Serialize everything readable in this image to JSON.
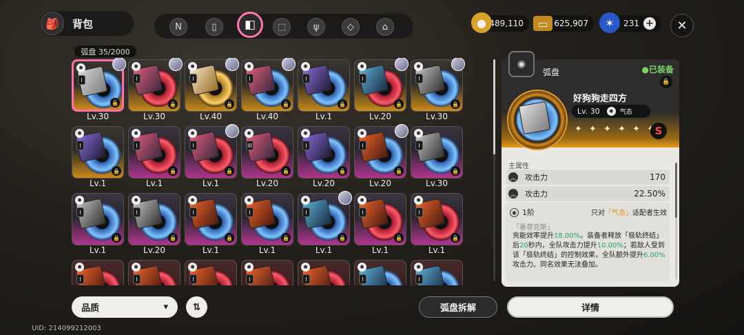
{
  "header": {
    "title": "背包",
    "bag_icon": "backpack-icon"
  },
  "tabs": [
    {
      "icon": "n-logo-icon"
    },
    {
      "icon": "device-icon"
    },
    {
      "icon": "disc-case-icon",
      "active": true
    },
    {
      "icon": "box-icon"
    },
    {
      "icon": "fork-knife-icon"
    },
    {
      "icon": "package-icon"
    },
    {
      "icon": "house-icon"
    }
  ],
  "currencies": [
    {
      "icon": "coin-icon",
      "value": "489,110"
    },
    {
      "icon": "ticket-icon",
      "value": "625,907"
    },
    {
      "icon": "crystal-icon",
      "value": "231"
    }
  ],
  "inventory": {
    "label": "弧盘 35/2000"
  },
  "items": [
    {
      "lv": "Lv.30",
      "rank": "I",
      "style": "gold",
      "cover": "",
      "disc": "",
      "avatar": true,
      "selected": true
    },
    {
      "lv": "Lv.30",
      "rank": "I",
      "style": "gold",
      "cover": "c2",
      "disc": "red",
      "avatar": true
    },
    {
      "lv": "Lv.40",
      "rank": "I",
      "style": "gold",
      "cover": "c3",
      "disc": "gold",
      "avatar": true
    },
    {
      "lv": "Lv.40",
      "rank": "I",
      "style": "gold",
      "cover": "c2",
      "disc": "",
      "avatar": true
    },
    {
      "lv": "Lv.1",
      "rank": "I",
      "style": "gold",
      "cover": "c4",
      "disc": "",
      "avatar": false
    },
    {
      "lv": "Lv.20",
      "rank": "I",
      "style": "gold",
      "cover": "c6",
      "disc": "red",
      "avatar": true
    },
    {
      "lv": "Lv.30",
      "rank": "I",
      "style": "gold",
      "cover": "c7",
      "disc": "",
      "avatar": true
    },
    {
      "lv": "Lv.1",
      "rank": "I",
      "style": "gold",
      "cover": "c4",
      "disc": "",
      "avatar": false
    },
    {
      "lv": "Lv.1",
      "rank": "I",
      "style": "purple",
      "cover": "c2",
      "disc": "red",
      "avatar": false
    },
    {
      "lv": "Lv.1",
      "rank": "I",
      "style": "purple",
      "cover": "c2",
      "disc": "red",
      "avatar": true
    },
    {
      "lv": "Lv.20",
      "rank": "III",
      "style": "purple",
      "cover": "c2",
      "disc": "red",
      "avatar": false
    },
    {
      "lv": "Lv.20",
      "rank": "I",
      "style": "purple",
      "cover": "c4",
      "disc": "",
      "avatar": false
    },
    {
      "lv": "Lv.20",
      "rank": "I",
      "style": "purple",
      "cover": "c5",
      "disc": "",
      "avatar": true
    },
    {
      "lv": "Lv.30",
      "rank": "I",
      "style": "purple",
      "cover": "c7",
      "disc": "",
      "avatar": false
    },
    {
      "lv": "Lv.1",
      "rank": "I",
      "style": "purple",
      "cover": "c7",
      "disc": "",
      "avatar": false
    },
    {
      "lv": "Lv.20",
      "rank": "I",
      "style": "purple",
      "cover": "c7",
      "disc": "",
      "avatar": false
    },
    {
      "lv": "Lv.1",
      "rank": "I",
      "style": "purple",
      "cover": "c5",
      "disc": "",
      "avatar": false
    },
    {
      "lv": "Lv.1",
      "rank": "I",
      "style": "purple",
      "cover": "c5",
      "disc": "",
      "avatar": false
    },
    {
      "lv": "Lv.1",
      "rank": "I",
      "style": "purple",
      "cover": "c6",
      "disc": "",
      "avatar": true
    },
    {
      "lv": "Lv.1",
      "rank": "I",
      "style": "purple",
      "cover": "c5",
      "disc": "red",
      "avatar": false
    },
    {
      "lv": "Lv.1",
      "rank": "I",
      "style": "purple",
      "cover": "c5",
      "disc": "red",
      "avatar": false
    },
    {
      "lv": "",
      "rank": "I",
      "style": "red",
      "cover": "c5",
      "disc": "red",
      "avatar": false
    },
    {
      "lv": "",
      "rank": "I",
      "style": "red",
      "cover": "c5",
      "disc": "red",
      "avatar": false
    },
    {
      "lv": "",
      "rank": "I",
      "style": "red",
      "cover": "c5",
      "disc": "red",
      "avatar": false
    },
    {
      "lv": "",
      "rank": "I",
      "style": "red",
      "cover": "c5",
      "disc": "red",
      "avatar": false
    },
    {
      "lv": "",
      "rank": "I",
      "style": "red",
      "cover": "c5",
      "disc": "red",
      "avatar": false
    },
    {
      "lv": "",
      "rank": "I",
      "style": "red",
      "cover": "c6",
      "disc": "",
      "avatar": false
    },
    {
      "lv": "",
      "rank": "I",
      "style": "red",
      "cover": "c6",
      "disc": "",
      "avatar": false
    }
  ],
  "panel": {
    "type_label": "弧盘",
    "equipped": "●已装备",
    "item_name": "好狗狗走四方",
    "level": "Lv. 30",
    "attribute": "气态",
    "stars": "✦ ✦ ✦ ✦ ✦ ✦",
    "star_badge": "S",
    "main_stats_label": "主属性",
    "stats": [
      {
        "name": "攻击力",
        "value": "170"
      },
      {
        "name": "攻击力",
        "value": "22.50%"
      }
    ],
    "effect": {
      "tier": "1阶",
      "target_prefix": "只对",
      "target_attr": "「气态」",
      "target_suffix": "适配者生效",
      "name": "「墨菲克斯」",
      "text_parts": [
        {
          "t": "充能效率提升",
          "c": ""
        },
        {
          "t": "18.00%",
          "c": "g"
        },
        {
          "t": "。装备者释放「极轨终结」后",
          "c": ""
        },
        {
          "t": "20",
          "c": "g"
        },
        {
          "t": "秒内，全队攻击力提升",
          "c": ""
        },
        {
          "t": "10.00%",
          "c": "g"
        },
        {
          "t": "；若敌人受到该「极轨终结」的控制效果，全队额外提升",
          "c": ""
        },
        {
          "t": "6.00%",
          "c": "g"
        },
        {
          "t": "攻击力。同名效果无法叠加。",
          "c": ""
        }
      ]
    }
  },
  "buttons": {
    "quality": "品质",
    "sort": "⇅",
    "dismantle": "弧盘拆解",
    "details": "详情",
    "close": "✕"
  },
  "footer": {
    "uid": "UID: 214099212003"
  }
}
